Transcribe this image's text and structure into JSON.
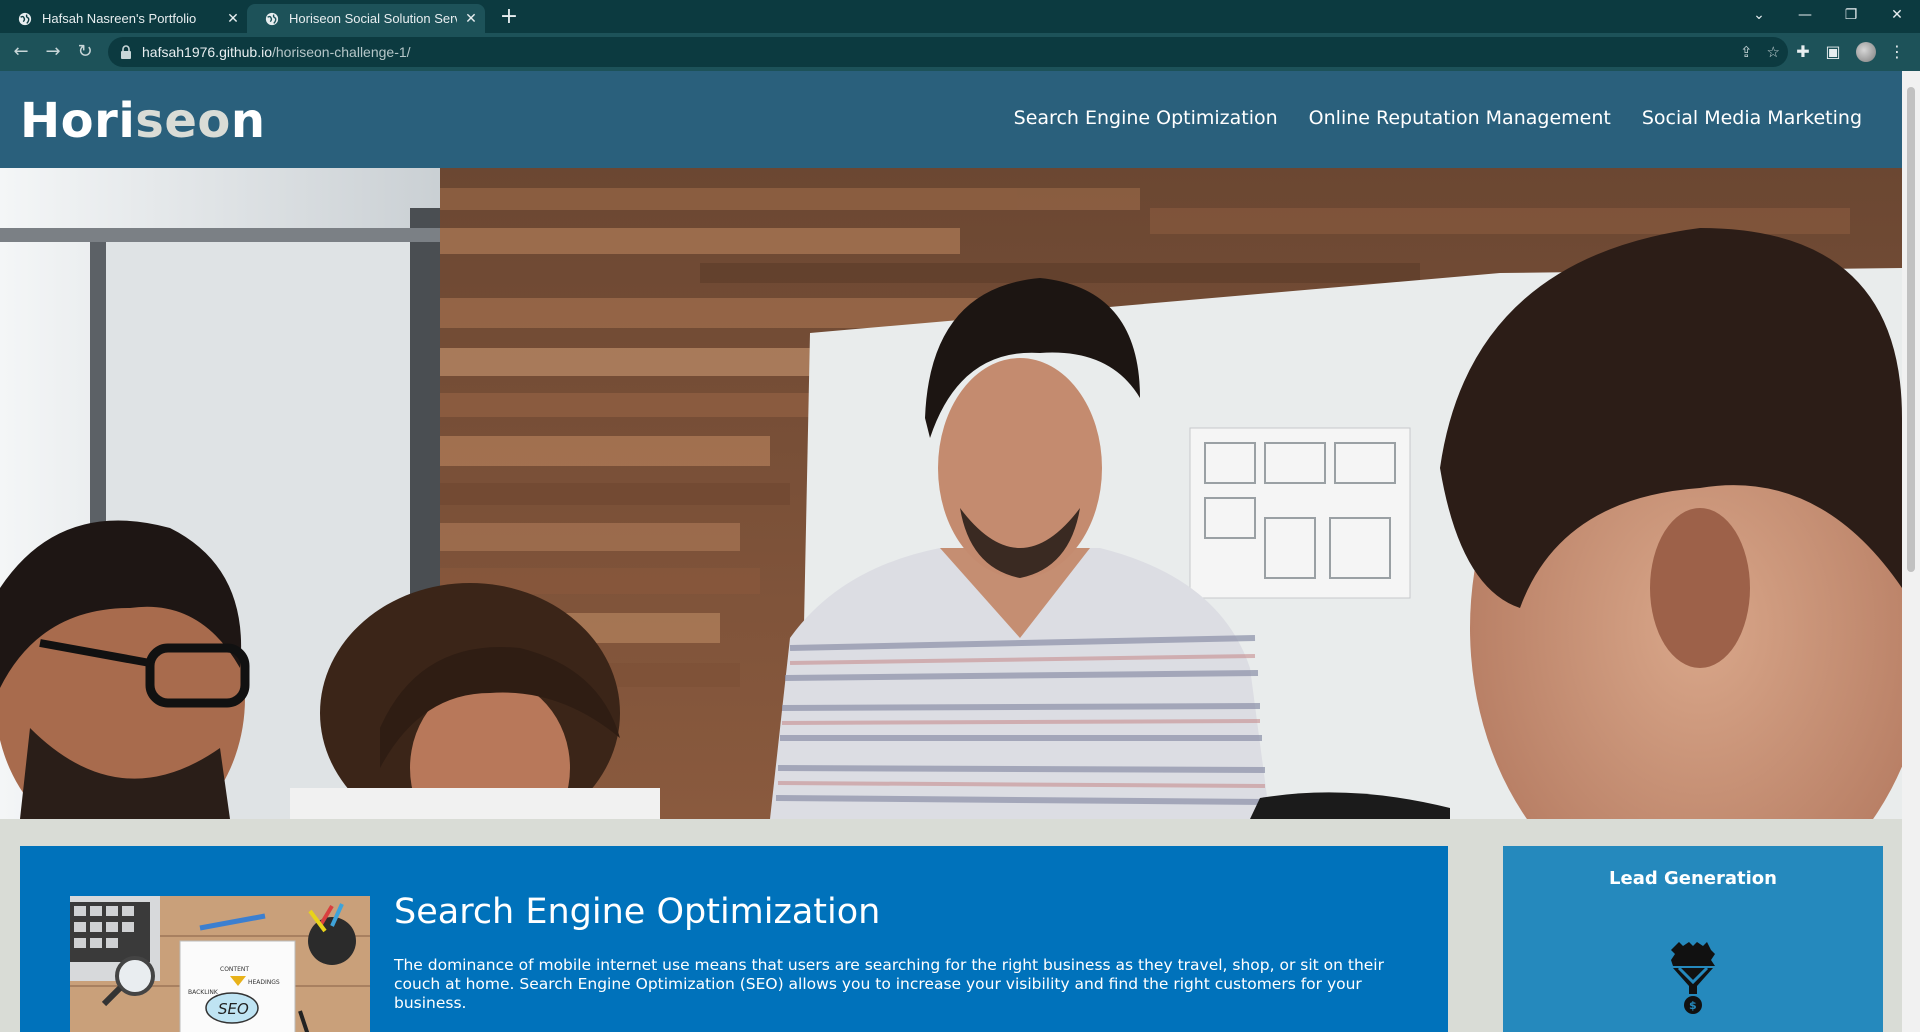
{
  "browser": {
    "tabs": [
      {
        "title": "Hafsah Nasreen's Portfolio",
        "active": false
      },
      {
        "title": "Horiseon Social Solution Services, Inc.",
        "active": true
      }
    ],
    "url_host": "hafsah1976.github.io",
    "url_path": "/horiseon-challenge-1/",
    "icons": {
      "back": "arrow-left-icon",
      "forward": "arrow-right-icon",
      "reload": "reload-icon",
      "share": "share-icon",
      "bookmark": "star-icon",
      "extensions": "puzzle-icon",
      "sidepanel": "side-panel-icon",
      "menu": "kebab-menu-icon"
    }
  },
  "site": {
    "logo_prefix": "Hori",
    "logo_highlight": "seo",
    "logo_suffix": "n",
    "nav": [
      "Search Engine Optimization",
      "Online Reputation Management",
      "Social Media Marketing"
    ],
    "colors": {
      "header_bg": "#2a607c",
      "page_bg": "#d9dcd6",
      "content_bg": "#0072bb",
      "aside_bg": "#2589bd"
    }
  },
  "main": {
    "seo_heading": "Search Engine Optimization",
    "seo_text": "The dominance of mobile internet use means that users are searching for the right business as they travel, shop, or sit on their couch at home. Search Engine Optimization (SEO) allows you to increase your visibility and find the right customers for your business.",
    "seo_image_labels": [
      "CONTENT",
      "HEADINGS",
      "BACKLINK",
      "SEO"
    ]
  },
  "aside": {
    "heading": "Lead Generation"
  }
}
